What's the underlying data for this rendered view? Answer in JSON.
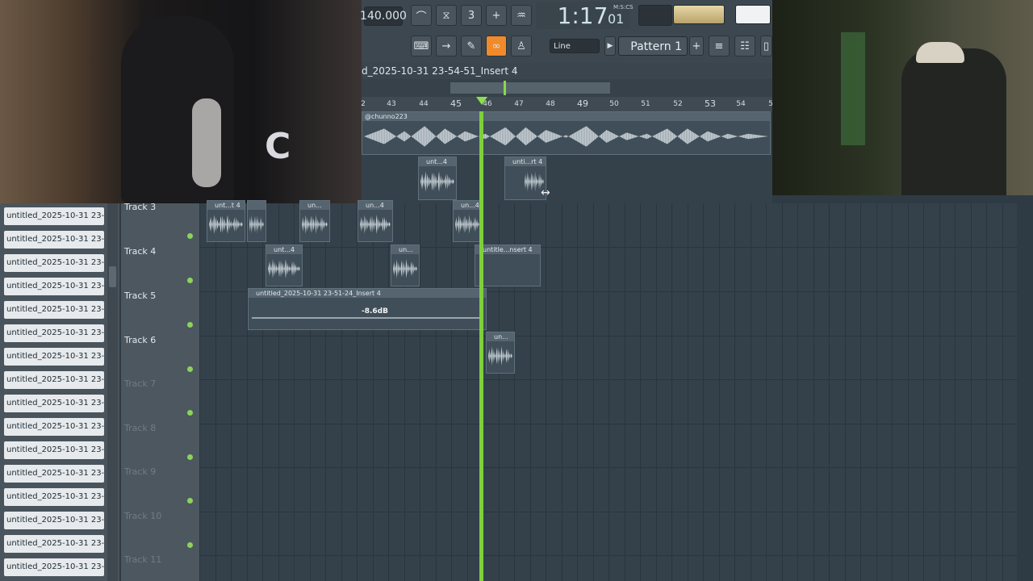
{
  "toolbar": {
    "bpm": "140.000",
    "time_display": "1:17",
    "time_sub": "01",
    "time_label": "M:S:CS",
    "line_mode": "Line",
    "pattern": "Pattern 1",
    "add_label": "+"
  },
  "playlist": {
    "title": "d_2025-10-31 23-54-51_Insert 4",
    "ruler": [
      "2",
      "43",
      "44",
      "45",
      "46",
      "47",
      "48",
      "49",
      "50",
      "51",
      "52",
      "53",
      "54",
      "5"
    ],
    "top_clip_label": "@chunno223",
    "tracks": [
      "Track 3",
      "Track 4",
      "Track 5",
      "Track 6",
      "Track 7",
      "Track 8",
      "Track 9",
      "Track 10",
      "Track 11"
    ],
    "clips": {
      "a1": "unt...4",
      "a2": "unti...rt 4",
      "t3_1": "unt...t 4",
      "t3_2": "un...",
      "t3_3": "un...4",
      "t3_4": "un...4",
      "t4_1": "unt...4",
      "t4_2": "un...",
      "t4_3": "untitle...nsert 4",
      "t5_1": "untitled_2025-10-31 23-51-24_Insert 4",
      "t5_gain": "-8.6dB",
      "t6_1": "un..."
    }
  },
  "browser": {
    "items": [
      "untitled_2025-10-31 23-...",
      "untitled_2025-10-31 23-...",
      "untitled_2025-10-31 23-...",
      "untitled_2025-10-31 23-...",
      "untitled_2025-10-31 23-...",
      "untitled_2025-10-31 23-...",
      "untitled_2025-10-31 23-...",
      "untitled_2025-10-31 23-...",
      "untitled_2025-10-31 23-...",
      "untitled_2025-10-31 23-...",
      "untitled_2025-10-31 23-...",
      "untitled_2025-10-31 23-...",
      "untitled_2025-10-31 23-...",
      "untitled_2025-10-31 23-...",
      "untitled_2025-10-31 23-...",
      "untitled_2025-10-31 23-..."
    ]
  },
  "colors": {
    "playhead": "#7ed03b",
    "pattern_link_active": "#f08a2b"
  }
}
